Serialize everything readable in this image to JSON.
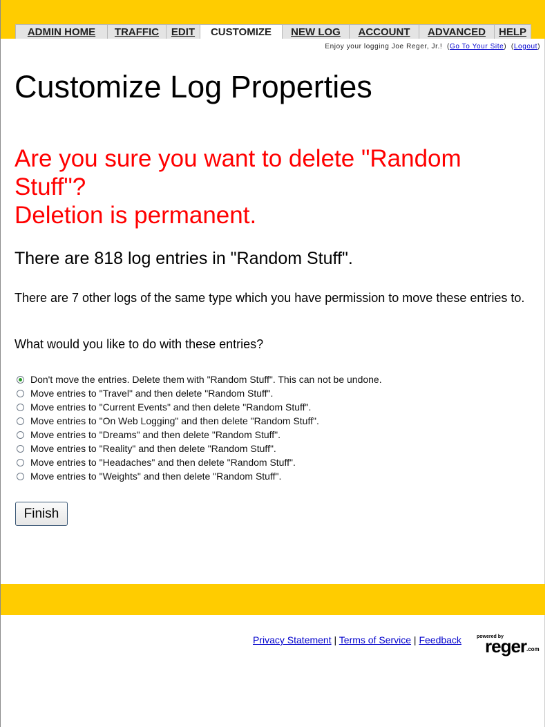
{
  "nav": {
    "tabs": [
      {
        "label": "ADMIN HOME",
        "active": false
      },
      {
        "label": "TRAFFIC",
        "active": false
      },
      {
        "label": "EDIT",
        "active": false
      },
      {
        "label": "CUSTOMIZE",
        "active": true
      },
      {
        "label": "NEW LOG",
        "active": false
      },
      {
        "label": "ACCOUNT",
        "active": false
      },
      {
        "label": "ADVANCED",
        "active": false
      },
      {
        "label": "HELP",
        "active": false
      }
    ]
  },
  "userbar": {
    "greeting": "Enjoy your logging Joe Reger, Jr.!",
    "site_link": "Go To Your Site",
    "logout_link": "Logout"
  },
  "page": {
    "title": "Customize Log Properties",
    "warning_line1": "Are you sure you want to delete \"Random Stuff\"?",
    "warning_line2": "Deletion is permanent.",
    "entry_count": "There are 818 log entries in \"Random Stuff\".",
    "other_logs": "There are 7 other logs of the same type which you have permission to move these entries to.",
    "question": "What would you like to do with these entries?"
  },
  "options": [
    {
      "label": "Don't move the entries. Delete them with \"Random Stuff\". This can not be undone.",
      "checked": true
    },
    {
      "label": "Move entries to \"Travel\" and then delete \"Random Stuff\".",
      "checked": false
    },
    {
      "label": "Move entries to \"Current Events\" and then delete \"Random Stuff\".",
      "checked": false
    },
    {
      "label": "Move entries to \"On Web Logging\" and then delete \"Random Stuff\".",
      "checked": false
    },
    {
      "label": "Move entries to \"Dreams\" and then delete \"Random Stuff\".",
      "checked": false
    },
    {
      "label": "Move entries to \"Reality\" and then delete \"Random Stuff\".",
      "checked": false
    },
    {
      "label": "Move entries to \"Headaches\" and then delete \"Random Stuff\".",
      "checked": false
    },
    {
      "label": "Move entries to \"Weights\" and then delete \"Random Stuff\".",
      "checked": false
    }
  ],
  "finish_label": "Finish",
  "footer": {
    "privacy": "Privacy Statement",
    "terms": "Terms of Service",
    "feedback": "Feedback",
    "separator": "|",
    "logo_powered": "powered by",
    "logo_name": "reger",
    "logo_suffix": ".com"
  },
  "colors": {
    "accent": "#ffcc00",
    "warning": "#ff0000",
    "link": "#0000cc"
  }
}
